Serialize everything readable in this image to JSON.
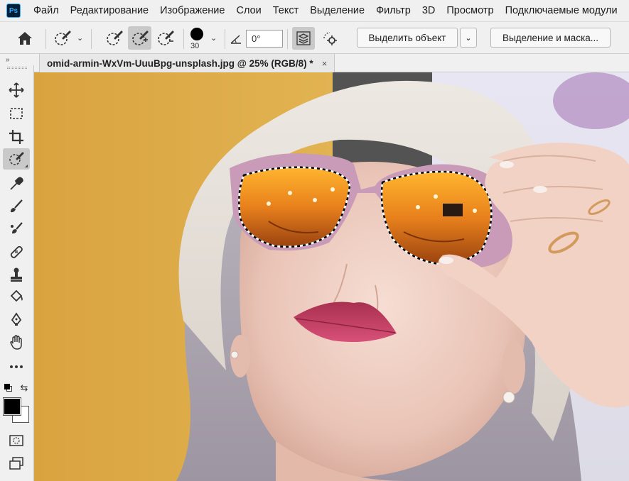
{
  "app": {
    "logo": "Ps"
  },
  "menu": [
    "Файл",
    "Редактирование",
    "Изображение",
    "Слои",
    "Текст",
    "Выделение",
    "Фильтр",
    "3D",
    "Просмотр",
    "Подключаемые модули"
  ],
  "options": {
    "brush_size": "30",
    "angle_value": "0°",
    "select_subject_label": "Выделить объект",
    "select_and_mask_label": "Выделение и маска..."
  },
  "document": {
    "tab_title": "omid-armin-WxVm-UuuBpg-unsplash.jpg @ 25% (RGB/8) *",
    "close_glyph": "×"
  },
  "toolbar": {
    "collapse_glyph": "»",
    "tools": [
      "move-tool",
      "marquee-tool",
      "crop-tool",
      "quick-selection-tool",
      "eyedropper-tool",
      "brush-tool",
      "mixer-brush-tool",
      "healing-tool",
      "stamp-tool",
      "paint-bucket-tool",
      "pen-tool",
      "hand-tool",
      "more-tools",
      "swap-colors",
      "color-swatches",
      "quick-mask",
      "screen-mode"
    ],
    "active_tool": "quick-selection-tool"
  },
  "colors": {
    "foreground": "#000000",
    "background": "#ffffff",
    "chrome": "#f0f0f0",
    "canvas_backdrop": "#535353"
  }
}
